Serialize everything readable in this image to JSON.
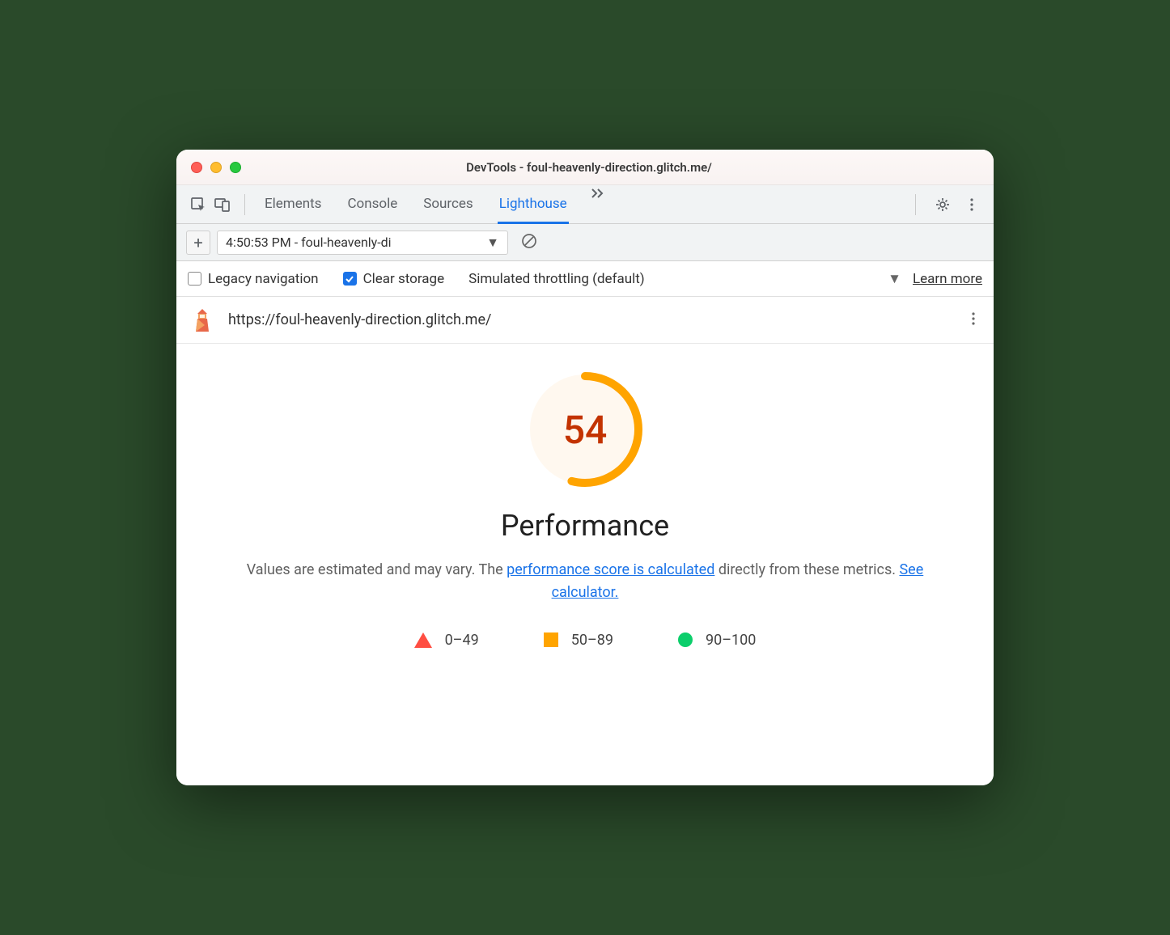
{
  "window_title": "DevTools - foul-heavenly-direction.glitch.me/",
  "tabs": {
    "elements": "Elements",
    "console": "Console",
    "sources": "Sources",
    "lighthouse": "Lighthouse"
  },
  "report_selector": "4:50:53 PM - foul-heavenly-di",
  "options": {
    "legacy_nav": "Legacy navigation",
    "clear_storage": "Clear storage",
    "throttling": "Simulated throttling (default)",
    "learn_more": "Learn more"
  },
  "url": "https://foul-heavenly-direction.glitch.me/",
  "gauge": {
    "score": "54",
    "color": "#fa3"
  },
  "section_title": "Performance",
  "desc_text1": "Values are estimated and may vary. The ",
  "desc_link1": "performance score is calculated",
  "desc_text2": " directly from these metrics. ",
  "desc_link2": "See calculator.",
  "legend": {
    "low": "0–49",
    "mid": "50–89",
    "high": "90–100"
  }
}
